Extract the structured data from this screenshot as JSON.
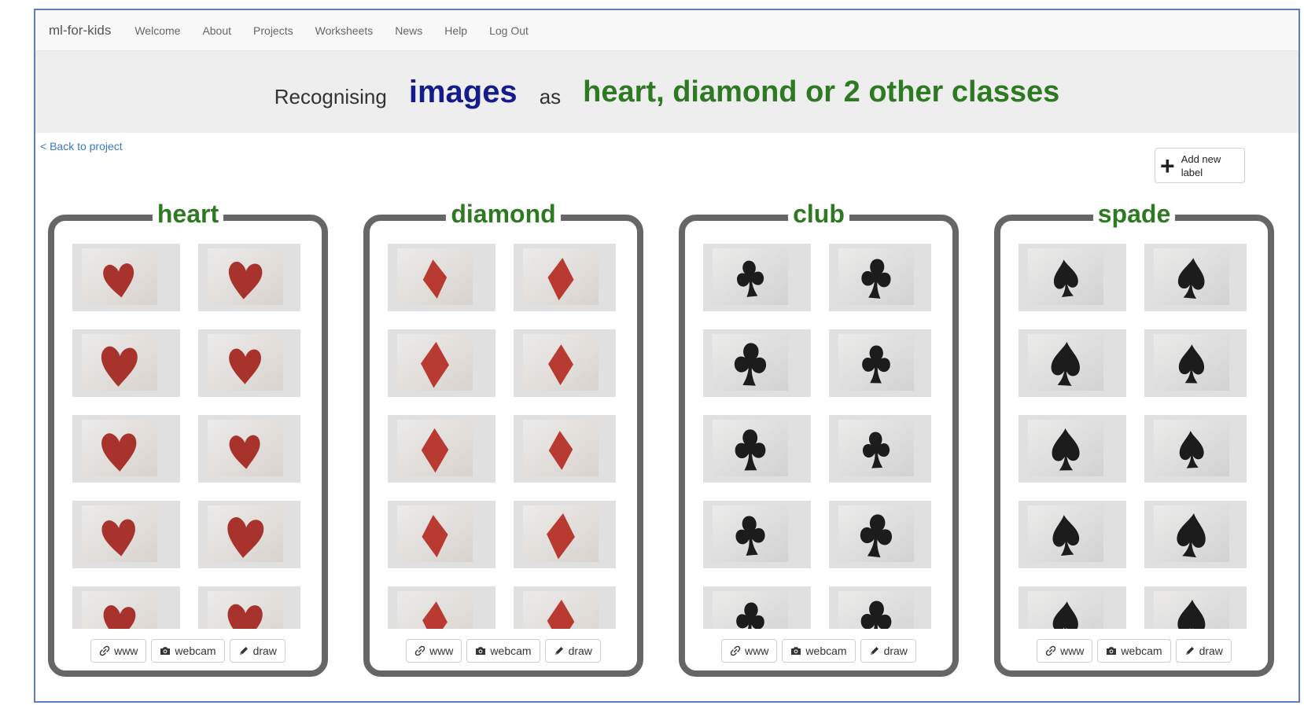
{
  "nav": {
    "brand": "ml-for-kids",
    "items": [
      "Welcome",
      "About",
      "Projects",
      "Worksheets",
      "News",
      "Help",
      "Log Out"
    ]
  },
  "banner": {
    "prefix": "Recognising",
    "type": "images",
    "middle": "as",
    "classes": "heart, diamond or 2 other classes"
  },
  "back_link": "< Back to project",
  "add_label": {
    "icon": "plus-icon",
    "label": "Add new label"
  },
  "buttons": {
    "www": "www",
    "webcam": "webcam",
    "draw": "draw"
  },
  "labels": [
    {
      "name": "heart",
      "suit": "heart",
      "color": "#a8332c",
      "tiles": 10
    },
    {
      "name": "diamond",
      "suit": "diamond",
      "color": "#b93a30",
      "tiles": 10
    },
    {
      "name": "club",
      "suit": "club",
      "color": "#1c1c1c",
      "tiles": 10
    },
    {
      "name": "spade",
      "suit": "spade",
      "color": "#1c1c1c",
      "tiles": 10
    }
  ],
  "colors": {
    "type_blue": "#141c8c",
    "label_green": "#2e7a22",
    "link_blue": "#3a78c4"
  }
}
